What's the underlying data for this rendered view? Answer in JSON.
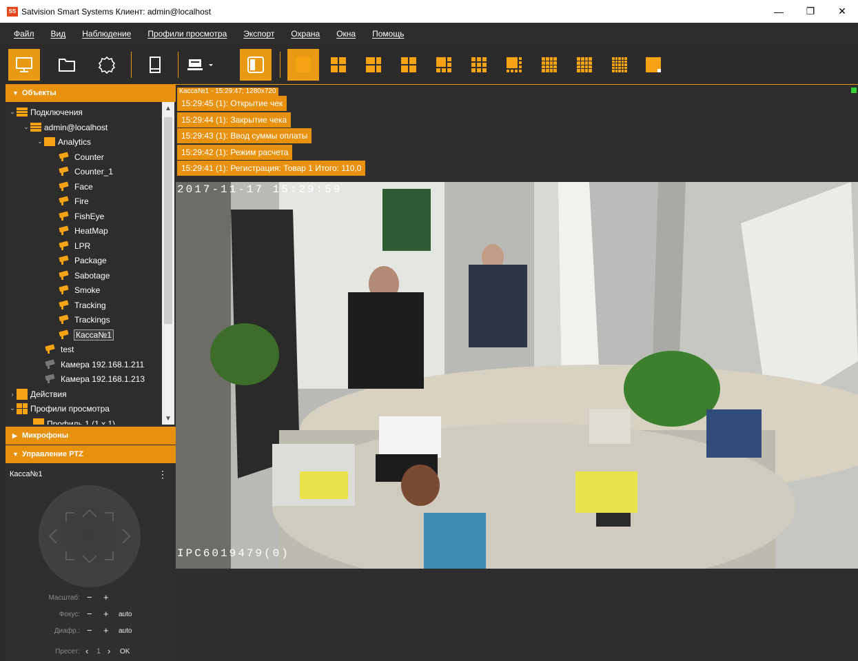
{
  "window": {
    "title": "Satvision Smart Systems Клиент: admin@localhost",
    "app_icon_text": "SS",
    "controls": {
      "minimize": "—",
      "restore": "❐",
      "close": "✕"
    }
  },
  "menu": [
    "Файл",
    "Вид",
    "Наблюдение",
    "Профили просмотра",
    "Экспорт",
    "Охрана",
    "Окна",
    "Помощь"
  ],
  "toolbar": {
    "modes": [
      "monitor-icon",
      "folder-icon",
      "settings-icon",
      "tablet-icon",
      "camera-device-icon",
      "panel-icon"
    ],
    "layouts": [
      "1x1",
      "2x2",
      "1+3",
      "2x2b",
      "1+5",
      "3x3",
      "1+7",
      "4x4",
      "4x4b",
      "5x5",
      "1x1-small"
    ]
  },
  "sidebar": {
    "objects_header": "Объекты",
    "tree": [
      {
        "label": "Подключения",
        "level": 0,
        "expanded": true,
        "icon": "server"
      },
      {
        "label": "admin@localhost",
        "level": 1,
        "expanded": true,
        "icon": "server"
      },
      {
        "label": "Analytics",
        "level": 2,
        "expanded": true,
        "icon": "folder"
      },
      {
        "label": "Counter",
        "level": 3,
        "icon": "camera"
      },
      {
        "label": "Counter_1",
        "level": 3,
        "icon": "camera"
      },
      {
        "label": "Face",
        "level": 3,
        "icon": "camera"
      },
      {
        "label": "Fire",
        "level": 3,
        "icon": "camera"
      },
      {
        "label": "FishEye",
        "level": 3,
        "icon": "camera"
      },
      {
        "label": "HeatMap",
        "level": 3,
        "icon": "camera"
      },
      {
        "label": "LPR",
        "level": 3,
        "icon": "camera"
      },
      {
        "label": "Package",
        "level": 3,
        "icon": "camera"
      },
      {
        "label": "Sabotage",
        "level": 3,
        "icon": "camera"
      },
      {
        "label": "Smoke",
        "level": 3,
        "icon": "camera"
      },
      {
        "label": "Tracking",
        "level": 3,
        "icon": "camera"
      },
      {
        "label": "Trackings",
        "level": 3,
        "icon": "camera"
      },
      {
        "label": "Касса№1",
        "level": 3,
        "icon": "camera",
        "selected": true
      },
      {
        "label": "test",
        "level": 2,
        "icon": "camera"
      },
      {
        "label": "Камера 192.168.1.211",
        "level": 2,
        "icon": "camera-gray"
      },
      {
        "label": "Камера 192.168.1.213",
        "level": 2,
        "icon": "camera-gray"
      },
      {
        "label": "Действия",
        "level": 0,
        "expanded": false,
        "icon": "square"
      },
      {
        "label": "Профили просмотра",
        "level": 0,
        "expanded": true,
        "icon": "grid"
      },
      {
        "label": "Профиль 1 (1 x 1)",
        "level": 1,
        "icon": "square"
      }
    ],
    "microphones_header": "Микрофоны",
    "ptz_header": "Управление PTZ",
    "ptz": {
      "camera_name": "Касса№1",
      "zoom_label": "Масштаб:",
      "focus_label": "Фокус:",
      "iris_label": "Диафр.:",
      "preset_label": "Пресет:",
      "auto_label": "auto",
      "preset_value": "1",
      "ok_label": "OK",
      "minus": "−",
      "plus": "+",
      "prev": "‹",
      "next": "›"
    }
  },
  "viewer": {
    "header": "Касса№1 - 15:29:47; 1280x720",
    "events": [
      "15:29:45 (1):  Открытие чек",
      "15:29:44 (1): Закрытие чека",
      "15:29:43 (1): Ввод суммы оплаты",
      "15:29:42 (1): Режим расчета",
      "15:29:41 (1):  Регистрация: Товар 1 Итого: 110,0"
    ],
    "osd_timestamp": "2017-11-17  15:29:59",
    "osd_camera": "IPC6019479(0)"
  },
  "colors": {
    "accent": "#e8910f",
    "panel": "#2d2d2d",
    "record": "#3ad03a"
  }
}
